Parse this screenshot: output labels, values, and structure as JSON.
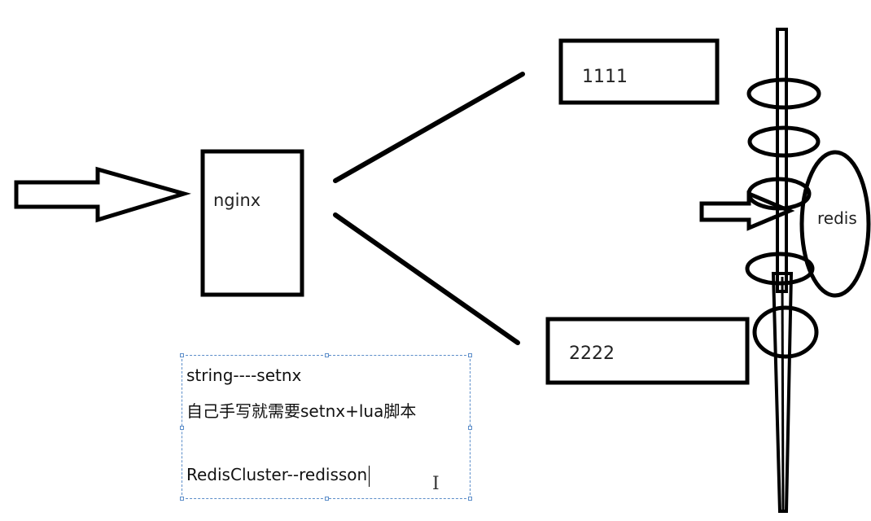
{
  "diagram": {
    "nginx_label": "nginx",
    "server1_label": "1111",
    "server2_label": "2222",
    "redis_label": "redis"
  },
  "textbox": {
    "lines": [
      "string----setnx",
      "自己手写就需要setnx+lua脚本",
      "",
      "RedisCluster--redisson"
    ]
  }
}
